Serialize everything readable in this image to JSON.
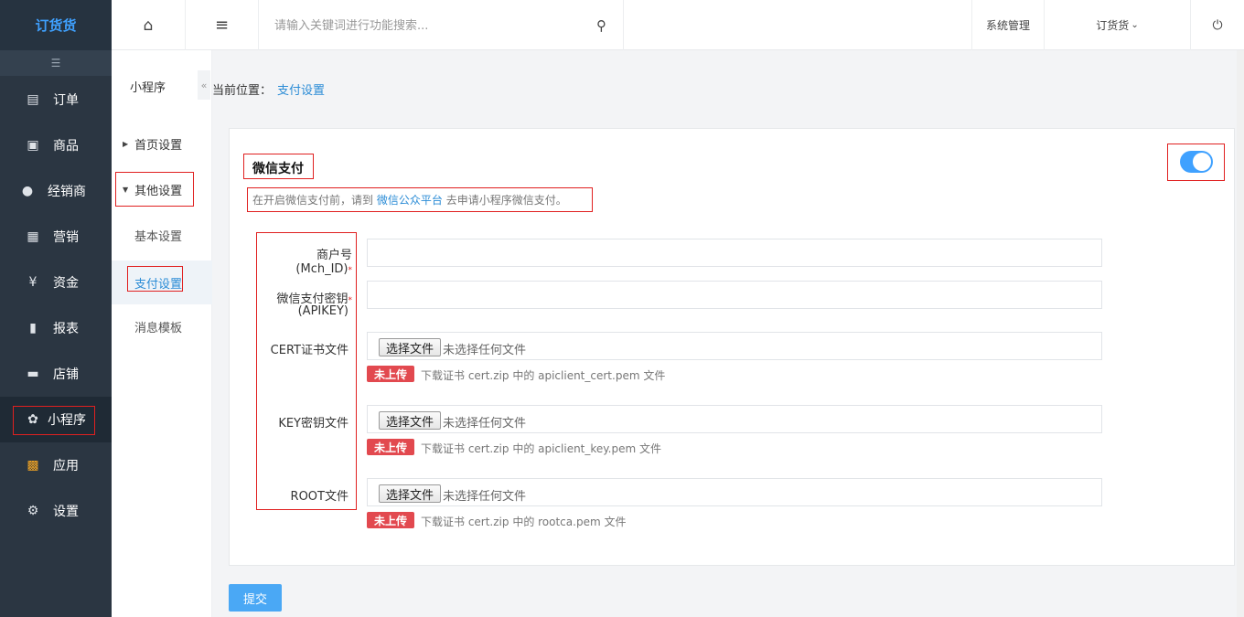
{
  "app": {
    "logo": "订货货"
  },
  "sidebar": {
    "collapse_icon": "☰",
    "items": [
      {
        "label": "订单",
        "icon": "document-icon",
        "glyph": "▤"
      },
      {
        "label": "商品",
        "icon": "product-icon",
        "glyph": "▣"
      },
      {
        "label": "经销商",
        "icon": "user-icon",
        "glyph": "●"
      },
      {
        "label": "营销",
        "icon": "gift-icon",
        "glyph": "▦"
      },
      {
        "label": "资金",
        "icon": "money-bag-icon",
        "glyph": "¥"
      },
      {
        "label": "报表",
        "icon": "bar-chart-icon",
        "glyph": "▮"
      },
      {
        "label": "店铺",
        "icon": "store-icon",
        "glyph": "▬"
      },
      {
        "label": "小程序",
        "icon": "miniprogram-icon",
        "glyph": "✿"
      },
      {
        "label": "应用",
        "icon": "apps-icon",
        "glyph": "▩"
      },
      {
        "label": "设置",
        "icon": "gear-icon",
        "glyph": "⚙"
      }
    ]
  },
  "topbar": {
    "home_glyph": "⌂",
    "menu_glyph": "≡",
    "search_placeholder": "请输入关键词进行功能搜索...",
    "search_glyph": "⚲",
    "system_manage": "系统管理",
    "user_menu": "订货货",
    "user_caret": "⌄",
    "power_glyph": "⏻"
  },
  "subnav": {
    "title": "小程序",
    "collapse_glyph": "«",
    "items": [
      {
        "label": "首页设置",
        "arrow": "▶"
      },
      {
        "label": "其他设置",
        "arrow": "▼"
      },
      {
        "label": "基本设置"
      },
      {
        "label": "支付设置"
      },
      {
        "label": "消息模板"
      }
    ]
  },
  "breadcrumb": {
    "prefix": "当前位置：",
    "current": "支付设置"
  },
  "wechat_pay": {
    "title": "微信支付",
    "notice_before": "在开启微信支付前，请到",
    "notice_link": "微信公众平台",
    "notice_after": "去申请小程序微信支付。",
    "enabled": true,
    "required_mark": "*",
    "fields": {
      "mch_id_label": "商户号(Mch_ID)",
      "mch_id_value": "",
      "apikey_label_1": "微信支付密钥",
      "apikey_label_2": "(APIKEY)",
      "apikey_value": "",
      "cert_label": "CERT证书文件",
      "key_label": "KEY密钥文件",
      "root_label": "ROOT文件"
    },
    "file_button": "选择文件",
    "file_status": "未选择任何文件",
    "upload_badge": "未上传",
    "hints": {
      "cert": "下载证书 cert.zip 中的 apiclient_cert.pem 文件",
      "key": "下载证书 cert.zip 中的 apiclient_key.pem 文件",
      "root": "下载证书 cert.zip 中的 rootca.pem 文件"
    },
    "submit": "提交"
  }
}
